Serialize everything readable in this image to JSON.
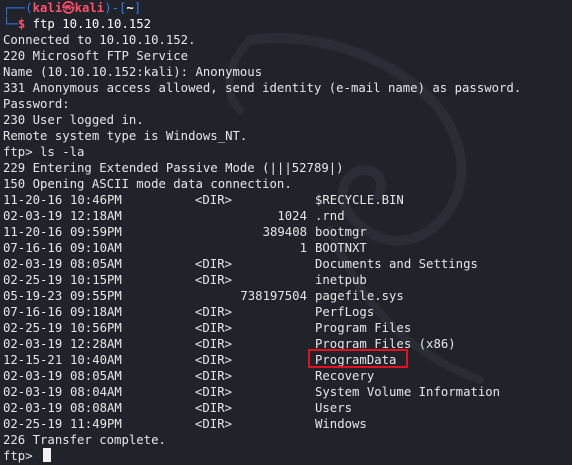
{
  "prompt": {
    "user": "kali",
    "at_symbol": "㉿",
    "host": "kali",
    "cwd": "~",
    "command": "ftp 10.10.10.152"
  },
  "output": {
    "connected": "Connected to 10.10.10.152.",
    "banner": "220 Microsoft FTP Service",
    "name_prompt": "Name (10.10.10.152:kali): Anonymous",
    "anon_msg": "331 Anonymous access allowed, send identity (e-mail name) as password.",
    "password": "Password:",
    "logged_in": "230 User logged in.",
    "system_type": "Remote system type is Windows_NT.",
    "ls_cmd": "ftp> ls -la",
    "passive": "229 Entering Extended Passive Mode (|||52789|)",
    "opening": "150 Opening ASCII mode data connection.",
    "transfer_done": "226 Transfer complete.",
    "final_prompt": "ftp> "
  },
  "listing": [
    {
      "date": "11-20-16",
      "time": "10:46PM",
      "dir": "<DIR>",
      "size": "",
      "name": "$RECYCLE.BIN"
    },
    {
      "date": "02-03-19",
      "time": "12:18AM",
      "dir": "",
      "size": "1024",
      "name": ".rnd"
    },
    {
      "date": "11-20-16",
      "time": "09:59PM",
      "dir": "",
      "size": "389408",
      "name": "bootmgr"
    },
    {
      "date": "07-16-16",
      "time": "09:10AM",
      "dir": "",
      "size": "1",
      "name": "BOOTNXT"
    },
    {
      "date": "02-03-19",
      "time": "08:05AM",
      "dir": "<DIR>",
      "size": "",
      "name": "Documents and Settings"
    },
    {
      "date": "02-25-19",
      "time": "10:15PM",
      "dir": "<DIR>",
      "size": "",
      "name": "inetpub"
    },
    {
      "date": "05-19-23",
      "time": "09:55PM",
      "dir": "",
      "size": "738197504",
      "name": "pagefile.sys"
    },
    {
      "date": "07-16-16",
      "time": "09:18AM",
      "dir": "<DIR>",
      "size": "",
      "name": "PerfLogs"
    },
    {
      "date": "02-25-19",
      "time": "10:56PM",
      "dir": "<DIR>",
      "size": "",
      "name": "Program Files"
    },
    {
      "date": "02-03-19",
      "time": "12:28AM",
      "dir": "<DIR>",
      "size": "",
      "name": "Program Files (x86)"
    },
    {
      "date": "12-15-21",
      "time": "10:40AM",
      "dir": "<DIR>",
      "size": "",
      "name": "ProgramData"
    },
    {
      "date": "02-03-19",
      "time": "08:05AM",
      "dir": "<DIR>",
      "size": "",
      "name": "Recovery"
    },
    {
      "date": "02-03-19",
      "time": "08:04AM",
      "dir": "<DIR>",
      "size": "",
      "name": "System Volume Information"
    },
    {
      "date": "02-03-19",
      "time": "08:08AM",
      "dir": "<DIR>",
      "size": "",
      "name": "Users"
    },
    {
      "date": "02-25-19",
      "time": "11:49PM",
      "dir": "<DIR>",
      "size": "",
      "name": "Windows"
    }
  ],
  "colors": {
    "background": "#21232b",
    "prompt_frame": "#2f7bf0",
    "prompt_user": "#ff4d6b",
    "highlight": "#e3101f"
  }
}
